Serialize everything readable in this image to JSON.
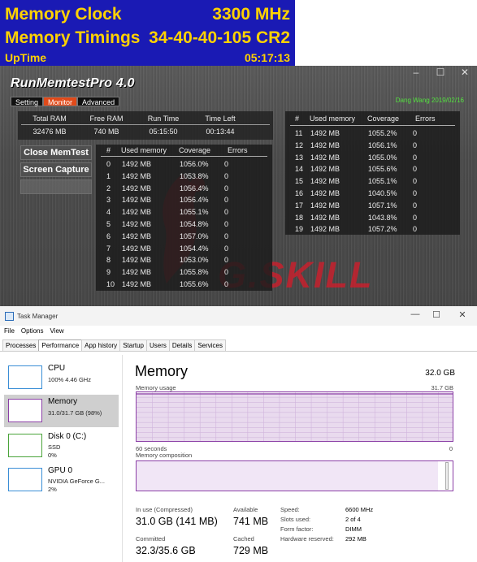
{
  "osd": {
    "memory_clock_label": "Memory Clock",
    "memory_clock_value": "3300 MHz",
    "memory_timings_label": "Memory Timings",
    "memory_timings_value": "34-40-40-105 CR2",
    "uptime_label": "UpTime",
    "uptime_value": "05:17:13",
    "bg_color": "#1a1ab4",
    "text_color": "#ffd200"
  },
  "memtest": {
    "title": "RunMemtestPro 4.0",
    "tabs": [
      "Setting",
      "Monitor",
      "Advanced"
    ],
    "active_tab": "Monitor",
    "author": "Dang Wang 2019/02/16",
    "stats": {
      "headers": [
        "Total RAM",
        "Free RAM",
        "Run Time",
        "Time Left"
      ],
      "values": [
        "32476 MB",
        "740 MB",
        "05:15:50",
        "00:13:44"
      ]
    },
    "buttons": {
      "close": "Close MemTest",
      "capture": "Screen Capture"
    },
    "table_headers": [
      "#",
      "Used memory",
      "Coverage",
      "Errors"
    ],
    "left_rows": [
      [
        "0",
        "1492 MB",
        "1056.0%",
        "0"
      ],
      [
        "1",
        "1492 MB",
        "1053.8%",
        "0"
      ],
      [
        "2",
        "1492 MB",
        "1056.4%",
        "0"
      ],
      [
        "3",
        "1492 MB",
        "1056.4%",
        "0"
      ],
      [
        "4",
        "1492 MB",
        "1055.1%",
        "0"
      ],
      [
        "5",
        "1492 MB",
        "1054.8%",
        "0"
      ],
      [
        "6",
        "1492 MB",
        "1057.0%",
        "0"
      ],
      [
        "7",
        "1492 MB",
        "1054.4%",
        "0"
      ],
      [
        "8",
        "1492 MB",
        "1053.0%",
        "0"
      ],
      [
        "9",
        "1492 MB",
        "1055.8%",
        "0"
      ],
      [
        "10",
        "1492 MB",
        "1055.6%",
        "0"
      ]
    ],
    "right_rows": [
      [
        "11",
        "1492 MB",
        "1055.2%",
        "0"
      ],
      [
        "12",
        "1492 MB",
        "1056.1%",
        "0"
      ],
      [
        "13",
        "1492 MB",
        "1055.0%",
        "0"
      ],
      [
        "14",
        "1492 MB",
        "1055.6%",
        "0"
      ],
      [
        "15",
        "1492 MB",
        "1055.1%",
        "0"
      ],
      [
        "16",
        "1492 MB",
        "1040.5%",
        "0"
      ],
      [
        "17",
        "1492 MB",
        "1057.1%",
        "0"
      ],
      [
        "18",
        "1492 MB",
        "1043.8%",
        "0"
      ],
      [
        "19",
        "1492 MB",
        "1057.2%",
        "0"
      ]
    ],
    "watermark": "G.SKILL",
    "accent_color": "#e04a1a",
    "author_color": "#54e040"
  },
  "taskmgr": {
    "title": "Task Manager",
    "menu": [
      "File",
      "Options",
      "View"
    ],
    "tabs": [
      "Processes",
      "Performance",
      "App history",
      "Startup",
      "Users",
      "Details",
      "Services"
    ],
    "active_tab": "Performance",
    "sidebar": [
      {
        "name": "CPU",
        "sub1": "100% 4.46 GHz",
        "sub2": ""
      },
      {
        "name": "Memory",
        "sub1": "31.0/31.7 GB (98%)",
        "sub2": ""
      },
      {
        "name": "Disk 0 (C:)",
        "sub1": "SSD",
        "sub2": "0%"
      },
      {
        "name": "GPU 0",
        "sub1": "NVIDIA GeForce G...",
        "sub2": "2%"
      }
    ],
    "memory": {
      "heading": "Memory",
      "total": "32.0 GB",
      "usage_label": "Memory usage",
      "usage_max": "31.7 GB",
      "time_left_label": "60 seconds",
      "time_right_label": "0",
      "composition_label": "Memory composition",
      "composition_fill": 0.98,
      "in_use_label": "In use (Compressed)",
      "in_use_value": "31.0 GB (141 MB)",
      "available_label": "Available",
      "available_value": "741 MB",
      "committed_label": "Committed",
      "committed_value": "32.3/35.6 GB",
      "cached_label": "Cached",
      "cached_value": "729 MB",
      "details": [
        {
          "label": "Speed:",
          "value": "6600 MHz"
        },
        {
          "label": "Slots used:",
          "value": "2 of 4"
        },
        {
          "label": "Form factor:",
          "value": "DIMM"
        },
        {
          "label": "Hardware reserved:",
          "value": "292 MB"
        }
      ],
      "accent_color": "#8b3fa6"
    }
  }
}
